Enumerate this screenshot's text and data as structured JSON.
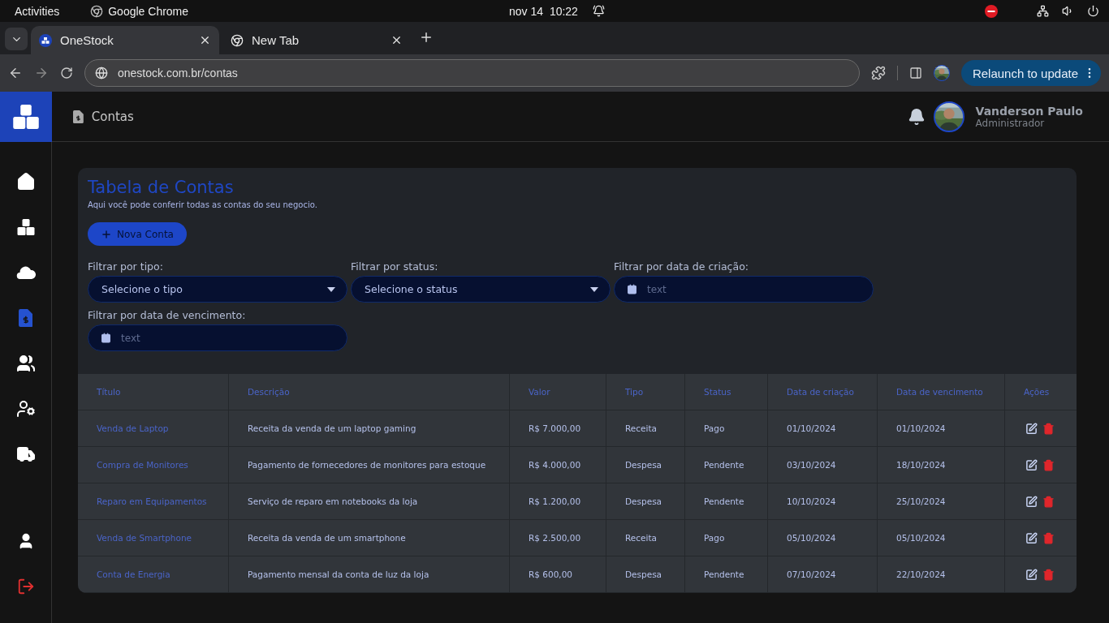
{
  "os_bar": {
    "activities": "Activities",
    "app": "Google Chrome",
    "date": "nov 14",
    "time": "10:22"
  },
  "browser": {
    "tabs": [
      {
        "title": "OneStock",
        "selected": true
      },
      {
        "title": "New Tab",
        "selected": false
      }
    ],
    "url": "onestock.com.br/contas",
    "relaunch": "Relaunch to update"
  },
  "sidebar": {
    "items": [
      {
        "kind": "home",
        "selected": false
      },
      {
        "kind": "stock",
        "selected": false
      },
      {
        "kind": "reports",
        "selected": false
      },
      {
        "kind": "accounts",
        "selected": true
      },
      {
        "kind": "users",
        "selected": false
      },
      {
        "kind": "user-settings",
        "selected": false
      },
      {
        "kind": "delivery",
        "selected": false
      }
    ],
    "bottom_items": [
      {
        "kind": "profile",
        "selected": false
      },
      {
        "kind": "logout",
        "selected": false
      }
    ]
  },
  "header": {
    "page": "Contas",
    "user_name": "Vanderson Paulo",
    "user_role": "Administrador"
  },
  "panel": {
    "title": "Tabela de Contas",
    "subtitle": "Aqui você pode conferir todas as contas do seu negocio.",
    "new_button": "Nova Conta",
    "filters": [
      {
        "kind": "select",
        "label": "Filtrar por tipo:",
        "value": "Selecione o tipo"
      },
      {
        "kind": "select",
        "label": "Filtrar por status:",
        "value": "Selecione o status"
      },
      {
        "kind": "date",
        "label": "Filtrar por data de criação:",
        "placeholder": "text"
      },
      {
        "kind": "date",
        "label": "Filtrar por data de vencimento:",
        "placeholder": "text"
      }
    ]
  },
  "table": {
    "columns": [
      "Título",
      "Descrição",
      "Valor",
      "Tipo",
      "Status",
      "Data de criação",
      "Data de vencimento",
      "Ações"
    ],
    "rows": [
      {
        "cells": [
          "Venda de Laptop",
          "Receita da venda de um laptop gaming",
          "R$ 7.000,00",
          "Receita",
          "Pago",
          "01/10/2024",
          "01/10/2024"
        ]
      },
      {
        "cells": [
          "Compra de Monitores",
          "Pagamento de fornecedores de monitores para estoque",
          "R$ 4.000,00",
          "Despesa",
          "Pendente",
          "03/10/2024",
          "18/10/2024"
        ]
      },
      {
        "cells": [
          "Reparo em Equipamentos",
          "Serviço de reparo em notebooks da loja",
          "R$ 1.200,00",
          "Despesa",
          "Pendente",
          "10/10/2024",
          "25/10/2024"
        ]
      },
      {
        "cells": [
          "Venda de Smartphone",
          "Receita da venda de um smartphone",
          "R$ 2.500,00",
          "Receita",
          "Pago",
          "05/10/2024",
          "05/10/2024"
        ]
      },
      {
        "cells": [
          "Conta de Energia",
          "Pagamento mensal da conta de luz da loja",
          "R$ 600,00",
          "Despesa",
          "Pendente",
          "07/10/2024",
          "22/10/2024"
        ]
      }
    ]
  }
}
